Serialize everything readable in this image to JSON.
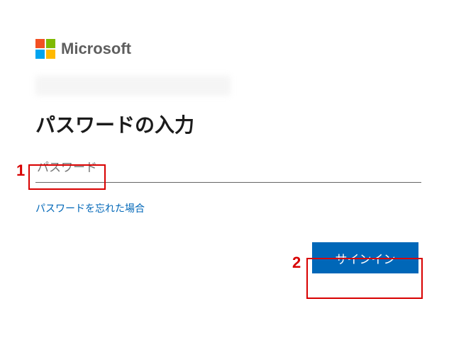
{
  "brand": {
    "name": "Microsoft"
  },
  "title": "パスワードの入力",
  "password": {
    "placeholder": "パスワード",
    "value": ""
  },
  "forgot_label": "パスワードを忘れた場合",
  "signin_label": "サインイン",
  "callouts": {
    "c1": "1",
    "c2": "2"
  }
}
